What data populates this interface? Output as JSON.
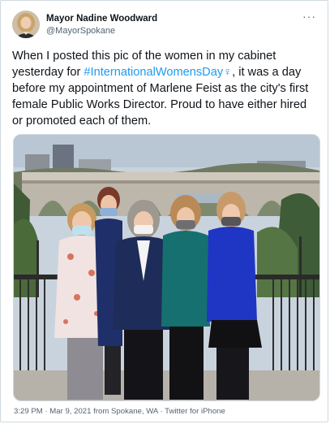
{
  "author": {
    "name": "Mayor Nadine Woodward",
    "handle": "@MayorSpokane"
  },
  "tweet": {
    "text_before": "When I posted this pic of the women in my cabinet yesterday for ",
    "hashtag": "#InternationalWomensDay",
    "emoji": "♀",
    "text_after": ", it was a day before my appointment of Marlene Feist as the city's first female Public Works Director. Proud to have either hired or promoted each of them."
  },
  "meta": {
    "time": "3:29 PM",
    "separator": "·",
    "date": "Mar 9, 2021",
    "location": "from Spokane, WA",
    "client": "Twitter for iPhone"
  },
  "icons": {
    "more": "more-horizontal-icon"
  },
  "colors": {
    "link": "#1d9bf0",
    "secondary_text": "#536471",
    "border": "#cfd9de"
  }
}
